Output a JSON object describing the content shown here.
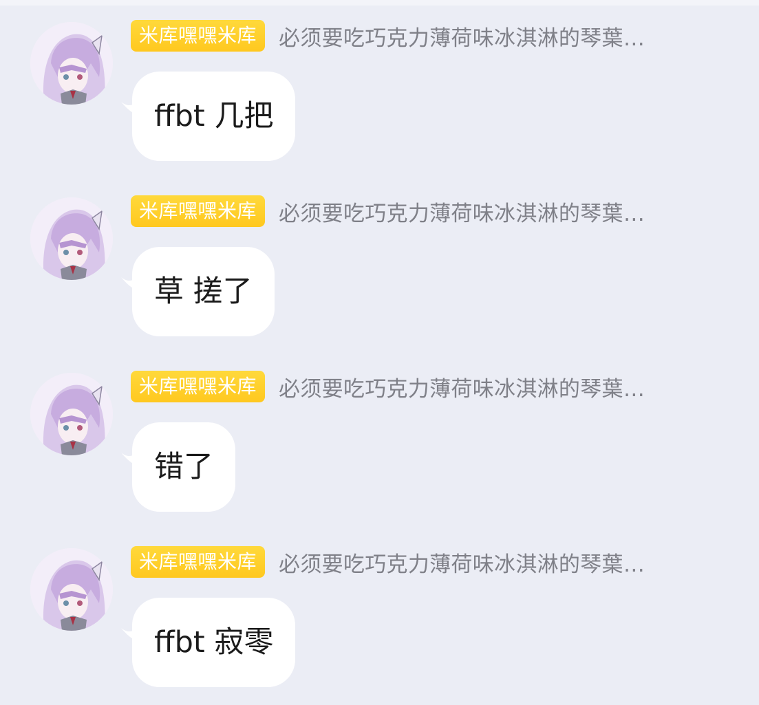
{
  "chat": {
    "messages": [
      {
        "badge": "米库嘿嘿米库",
        "sender": "必须要吃巧克力薄荷味冰淇淋的琴葉…",
        "text": "ffbt  几把"
      },
      {
        "badge": "米库嘿嘿米库",
        "sender": "必须要吃巧克力薄荷味冰淇淋的琴葉…",
        "text": "草 搓了"
      },
      {
        "badge": "米库嘿嘿米库",
        "sender": "必须要吃巧克力薄荷味冰淇淋的琴葉…",
        "text": "错了"
      },
      {
        "badge": "米库嘿嘿米库",
        "sender": "必须要吃巧克力薄荷味冰淇淋的琴葉…",
        "text": "ffbt 寂零"
      }
    ]
  },
  "colors": {
    "background": "#ebedf5",
    "badge": "#ffd23a",
    "badge_text": "#ffffff",
    "sender_text": "#7f8088",
    "bubble": "#ffffff",
    "message_text": "#1b1b1b"
  },
  "icons": {
    "avatar": "anime-avatar-icon"
  }
}
